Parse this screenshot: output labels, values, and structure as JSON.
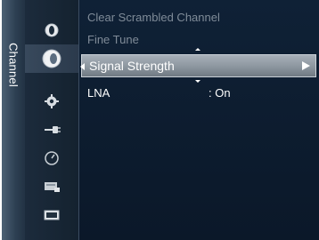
{
  "sidebar": {
    "section_label": "Channel",
    "icons": [
      {
        "name": "picture-icon"
      },
      {
        "name": "channel-icon",
        "selected": true
      },
      {
        "name": "setup-icon"
      },
      {
        "name": "input-icon"
      },
      {
        "name": "application-icon"
      },
      {
        "name": "support-icon"
      },
      {
        "name": "screen-icon"
      }
    ]
  },
  "menu": {
    "items": [
      {
        "label": "Clear Scrambled Channel",
        "dimmed": true
      },
      {
        "label": "Fine Tune",
        "dimmed": true
      },
      {
        "label": "Signal Strength",
        "selected": true,
        "has_submenu": true
      },
      {
        "label": "LNA",
        "value": ": On"
      }
    ]
  },
  "colors": {
    "background": "#0e1a2a",
    "highlight": "#9aa3ac",
    "text": "#ffffff",
    "dimmed_text": "#7f8b98"
  }
}
